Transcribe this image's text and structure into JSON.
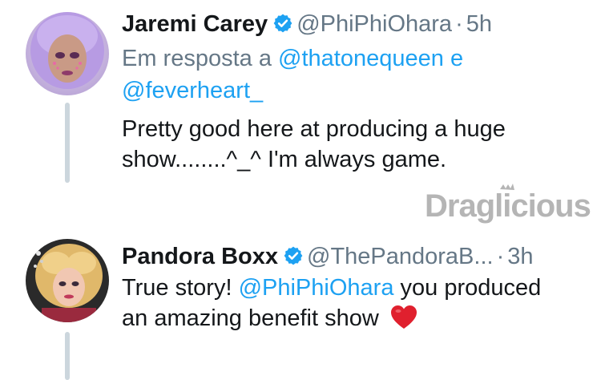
{
  "tweets": [
    {
      "author_name": "Jaremi Carey",
      "handle": "@PhiPhiOhara",
      "separator": "·",
      "time": "5h",
      "reply_prefix": "Em resposta a",
      "reply_mention_1": "@thatonequeen",
      "reply_conjunction": "e",
      "reply_mention_2": "@feverheart_",
      "text_line_1": "Pretty good here at producing a huge",
      "text_line_2": "show........^_^ I'm always game."
    },
    {
      "author_name": "Pandora Boxx",
      "handle": "@ThePandoraB...",
      "separator": "·",
      "time": "3h",
      "text_line_1_prefix": "True story!",
      "text_line_1_mention": "@PhiPhiOhara",
      "text_line_1_suffix": "you produced",
      "text_line_2": "an amazing benefit show",
      "emoji": "red-heart"
    }
  ],
  "watermark": {
    "text": "Draglicious"
  },
  "colors": {
    "link": "#1da1f2",
    "secondary": "#657786",
    "verified": "#1da1f2",
    "thread_line": "#ccd6dd"
  }
}
